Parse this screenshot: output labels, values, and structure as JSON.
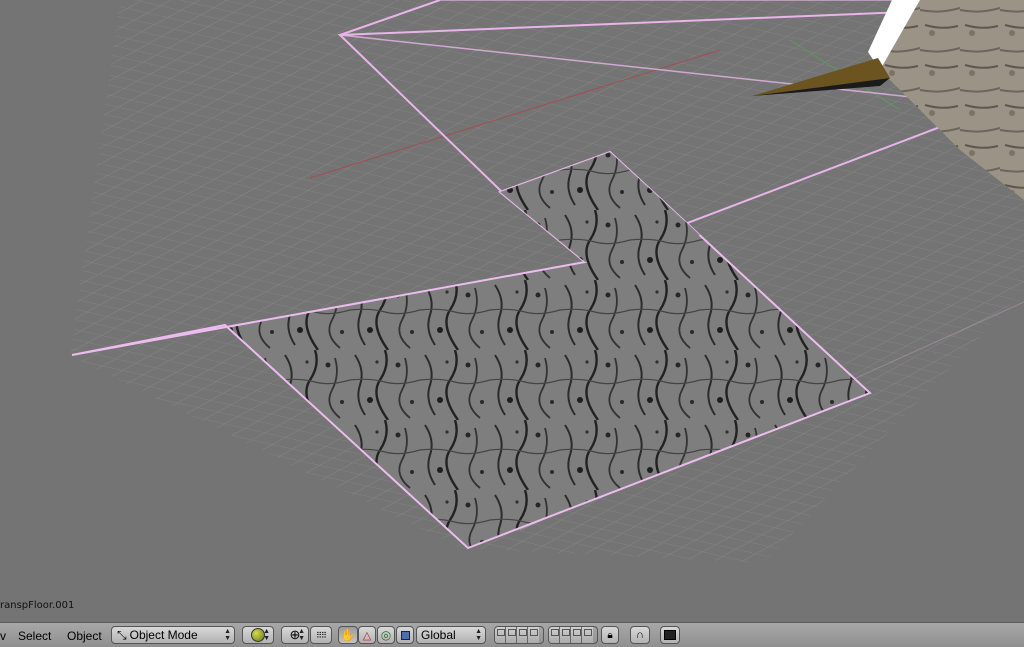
{
  "viewport": {
    "object_name": "ranspFloor.001",
    "colors": {
      "background": "#747474",
      "grid": "#8c8c8c",
      "selection_outline": "#e8b4ea",
      "x_axis": "#a05050",
      "y_axis": "#5a9a5a"
    }
  },
  "header": {
    "menu_view": "v",
    "menu_select": "Select",
    "menu_object": "Object",
    "mode_label": "Object Mode",
    "orientation_label": "Global",
    "icons": {
      "mode": "object-mode-icon",
      "shading": "shading-icon",
      "pivot": "pivot-icon",
      "dots": "pivot-dots-icon",
      "hand": "hand-icon",
      "translate": "translate-manipulator-icon",
      "rotate": "rotate-manipulator-icon",
      "scale": "scale-manipulator-icon",
      "lock": "lock-icon",
      "snap": "snap-icon",
      "render": "render-icon"
    }
  }
}
